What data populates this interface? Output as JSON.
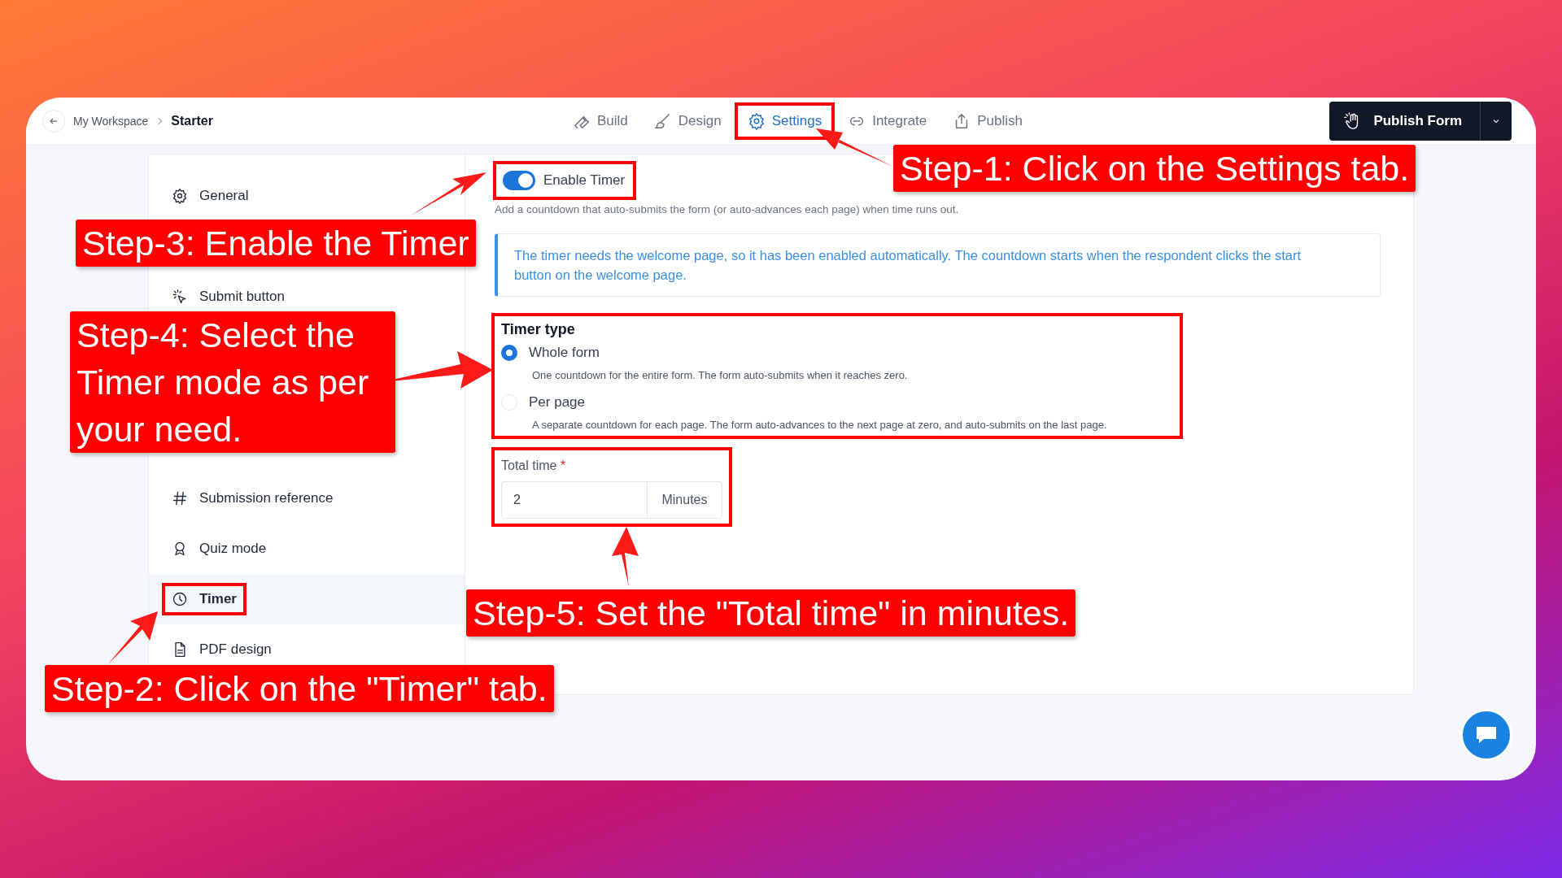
{
  "topbar": {
    "breadcrumb": [
      "My Workspace",
      "Starter"
    ],
    "tabs": [
      {
        "label": "Build",
        "selected": false,
        "highlighted": false
      },
      {
        "label": "Design",
        "selected": false,
        "highlighted": false
      },
      {
        "label": "Settings",
        "selected": true,
        "highlighted": true
      },
      {
        "label": "Integrate",
        "selected": false,
        "highlighted": false
      },
      {
        "label": "Publish",
        "selected": false,
        "highlighted": false
      }
    ],
    "publish_button": "Publish Form"
  },
  "sidebar": {
    "items": [
      {
        "label": "General",
        "selected": false,
        "highlighted": false
      },
      {
        "label": "Submit button",
        "selected": false,
        "highlighted": false
      },
      {
        "label": "Submission reference",
        "selected": false,
        "highlighted": false
      },
      {
        "label": "Quiz mode",
        "selected": false,
        "highlighted": false
      },
      {
        "label": "Timer",
        "selected": true,
        "highlighted": true
      },
      {
        "label": "PDF design",
        "selected": false,
        "highlighted": false
      }
    ]
  },
  "timer": {
    "enable": {
      "label": "Enable Timer",
      "on": true,
      "highlighted": true
    },
    "description": "Add a countdown that auto-submits the form (or auto-advances each page) when time runs out.",
    "info": "The timer needs the welcome page, so it has been enabled automatically. The countdown starts when the respondent clicks the start button on the welcome page.",
    "timer_type": {
      "title": "Timer type",
      "highlighted": true,
      "options": [
        {
          "label": "Whole form",
          "description": "One countdown for the entire form. The form auto-submits when it reaches zero.",
          "selected": true
        },
        {
          "label": "Per page",
          "description": "A separate countdown for each page. The form auto-advances to the next page at zero, and auto-submits on the last page.",
          "selected": false
        }
      ]
    },
    "total_time": {
      "label": "Total time",
      "required_mark": "*",
      "value": "2",
      "unit": "Minutes",
      "highlighted": true
    }
  },
  "annotations": [
    {
      "text": "Step-1: Click on the Settings tab."
    },
    {
      "text": "Step-3: Enable the Timer"
    },
    {
      "text": "Step-4: Select the Timer mode as per your need."
    },
    {
      "text": "Step-5: Set the \"Total time\" in minutes."
    },
    {
      "text": "Step-2: Click on the \"Timer\" tab."
    }
  ]
}
